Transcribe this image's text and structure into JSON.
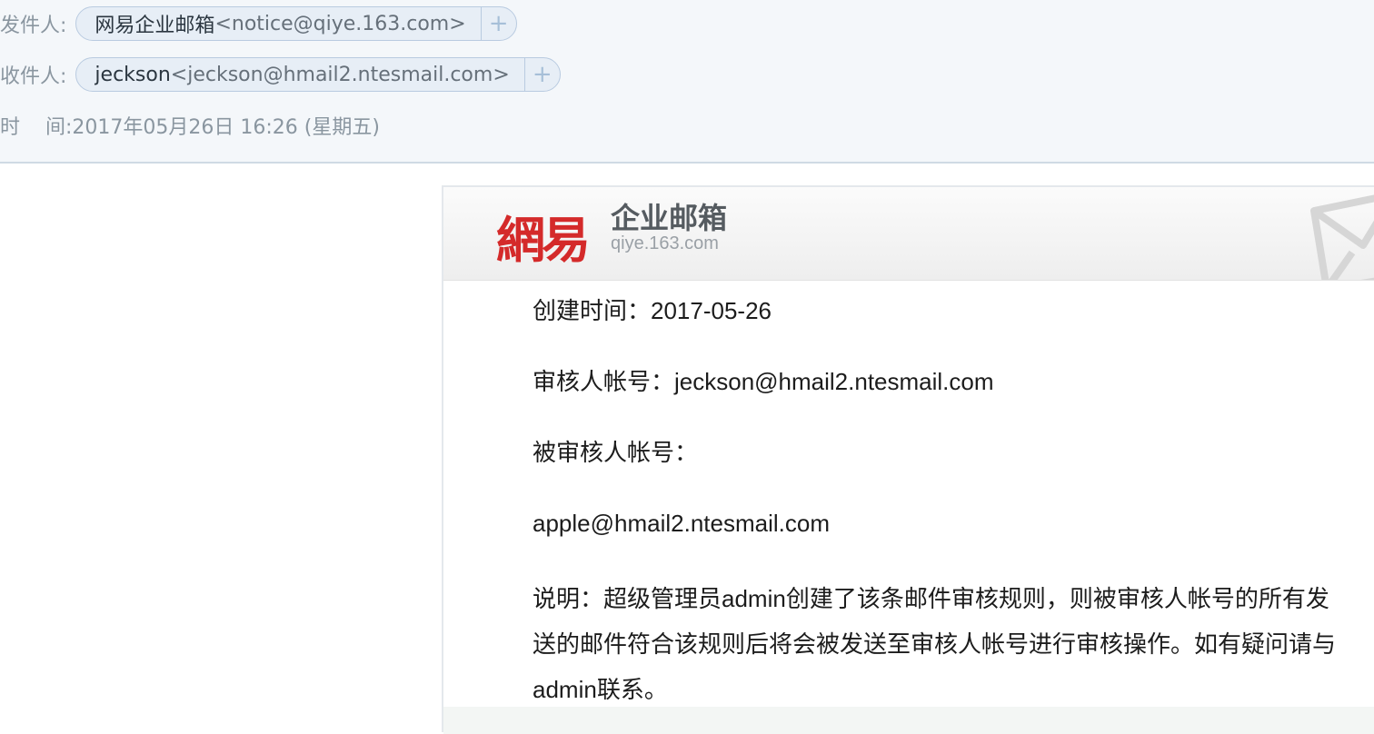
{
  "header": {
    "from_label": "发件人:",
    "from_name": "网易企业邮箱",
    "from_addr": "<notice@qiye.163.com>",
    "to_label": "收件人:",
    "to_name": "jeckson",
    "to_addr": "<jeckson@hmail2.ntesmail.com>",
    "time_label": "时    间:",
    "time_value": "2017年05月26日 16:26 (星期五)",
    "plus": "+"
  },
  "banner": {
    "logo_cn": "網易",
    "product": "企业邮箱",
    "domain": "qiye.163.com"
  },
  "content": {
    "created": "创建时间：2017-05-26",
    "reviewer": "审核人帐号：jeckson@hmail2.ntesmail.com",
    "reviewee_label": "被审核人帐号：",
    "reviewee_addr": "apple@hmail2.ntesmail.com",
    "desc": "说明：超级管理员admin创建了该条邮件审核规则，则被审核人帐号的所有发送的邮件符合该规则后将会被发送至审核人帐号进行审核操作。如有疑问请与admin联系。"
  },
  "colors": {
    "brand_red": "#d42a2a",
    "header_bg": "#f4f7fa",
    "pill_bg": "#e7eef6"
  }
}
